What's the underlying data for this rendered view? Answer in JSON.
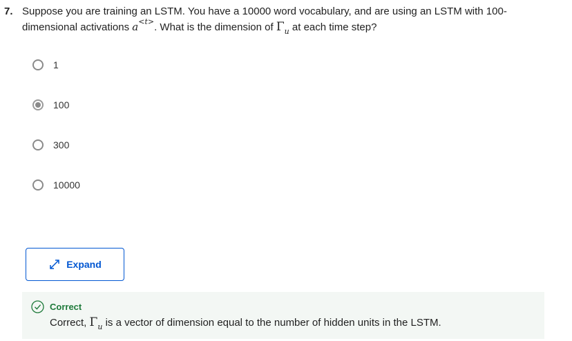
{
  "question": {
    "number": "7.",
    "text_part1": "Suppose you are training an LSTM. You have a 10000 word vocabulary, and are using an LSTM with 100-dimensional activations ",
    "math_var": "a",
    "math_sup_open": "<",
    "math_sup_var": "t",
    "math_sup_close": ">",
    "text_part2": ". What is the dimension of ",
    "gamma": "Γ",
    "gamma_sub": "u",
    "text_part3": " at each time step?"
  },
  "options": [
    {
      "label": "1",
      "selected": false
    },
    {
      "label": "100",
      "selected": true
    },
    {
      "label": "300",
      "selected": false
    },
    {
      "label": "10000",
      "selected": false
    }
  ],
  "expand_button": {
    "label": "Expand",
    "icon": "expand-arrows-icon"
  },
  "feedback": {
    "status": "Correct",
    "icon": "check-circle-icon",
    "text_prefix": "Correct, ",
    "gamma": "Γ",
    "gamma_sub": "u",
    "text_suffix": " is a vector of dimension equal to the number of hidden units in the LSTM."
  },
  "colors": {
    "accent": "#0056d2",
    "success": "#1e7a3a",
    "feedback_bg": "#f3f7f4"
  }
}
